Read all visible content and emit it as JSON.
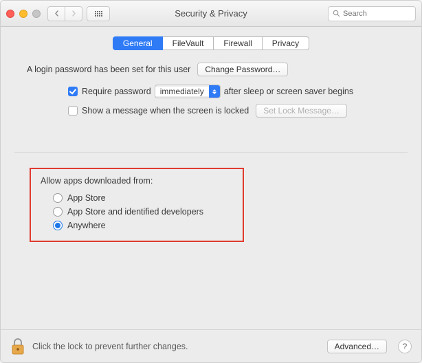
{
  "window": {
    "title": "Security & Privacy"
  },
  "search": {
    "placeholder": "Search"
  },
  "tabs": {
    "general": "General",
    "filevault": "FileVault",
    "firewall": "Firewall",
    "privacy": "Privacy",
    "active": "general"
  },
  "login": {
    "status_text": "A login password has been set for this user",
    "change_btn": "Change Password…",
    "require_label_before": "Require password",
    "require_select_value": "immediately",
    "require_label_after": "after sleep or screen saver begins",
    "require_checked": true,
    "show_message_label": "Show a message when the screen is locked",
    "show_message_checked": false,
    "set_lock_btn": "Set Lock Message…"
  },
  "gatekeeper": {
    "title": "Allow apps downloaded from:",
    "options": {
      "appstore": "App Store",
      "identified": "App Store and identified developers",
      "anywhere": "Anywhere"
    },
    "selected": "anywhere",
    "highlighted": true
  },
  "footer": {
    "lock_text": "Click the lock to prevent further changes.",
    "advanced_btn": "Advanced…"
  }
}
